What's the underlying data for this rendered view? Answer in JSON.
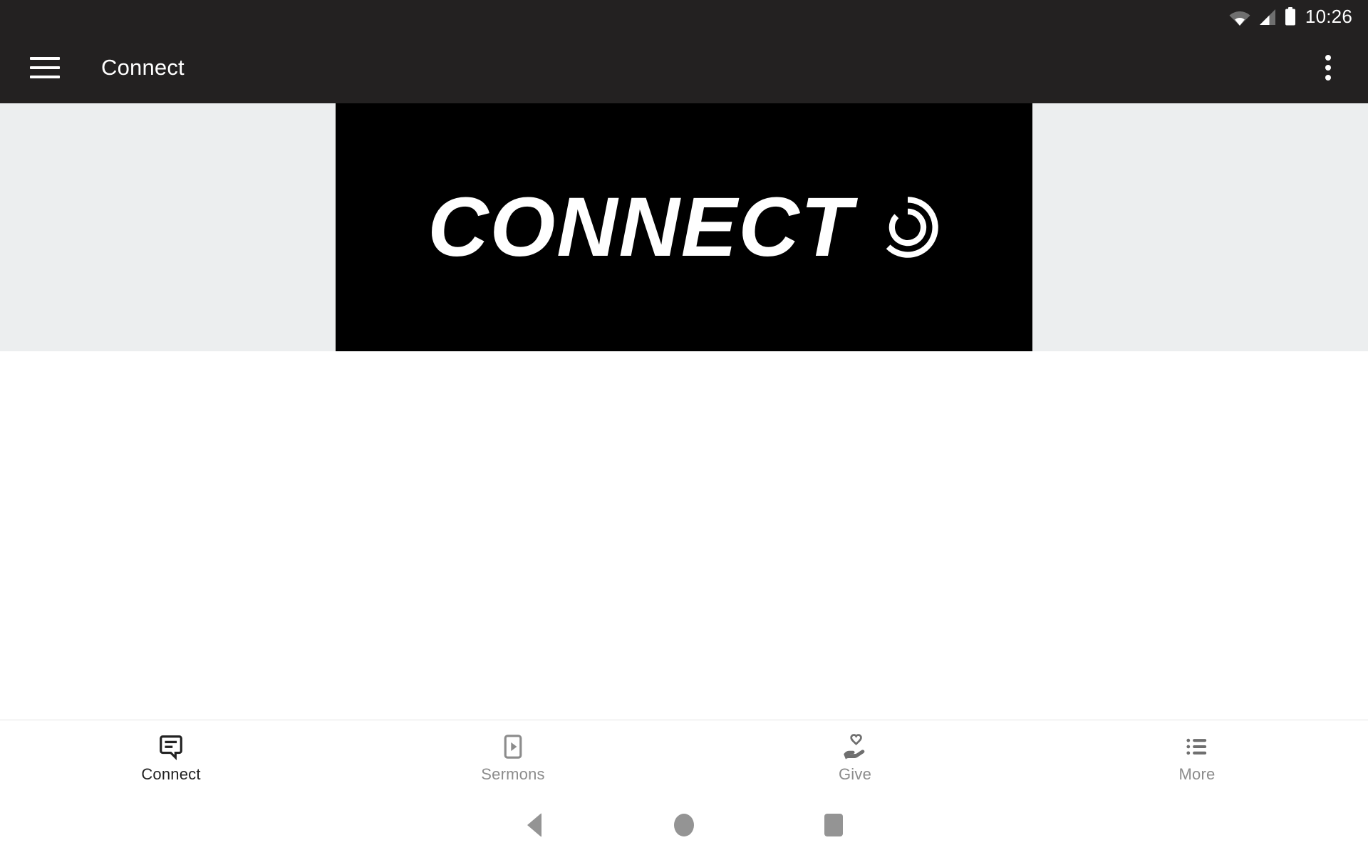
{
  "status_bar": {
    "time": "10:26",
    "icons": [
      "wifi-icon",
      "cellular-signal-icon",
      "battery-icon"
    ],
    "background_color": "#232121"
  },
  "app_bar": {
    "menu_icon": "hamburger-menu-icon",
    "title": "Connect",
    "overflow_icon": "overflow-menu-icon",
    "background_color": "#232121",
    "text_color": "#ffffff"
  },
  "banner": {
    "band_color": "#ECEEEF",
    "image_background": "#000000",
    "wordmark": "CONNECT",
    "logo_mark": "connect-rings-logo-icon",
    "text_color": "#ffffff"
  },
  "content": {
    "background_color": "#ffffff",
    "body_text": ""
  },
  "tab_bar": {
    "background_color": "#ffffff",
    "active_color": "#222222",
    "inactive_color": "#8c8c8c",
    "tabs": [
      {
        "label": "Connect",
        "icon": "chat-bubble-icon",
        "active": true
      },
      {
        "label": "Sermons",
        "icon": "video-play-device-icon",
        "active": false
      },
      {
        "label": "Give",
        "icon": "hand-holding-heart-icon",
        "active": false
      },
      {
        "label": "More",
        "icon": "bulleted-list-icon",
        "active": false
      }
    ]
  },
  "system_nav": {
    "background_color": "#ffffff",
    "icon_color": "#949494",
    "buttons": [
      {
        "name": "back",
        "icon": "back-triangle-icon"
      },
      {
        "name": "home",
        "icon": "home-circle-icon"
      },
      {
        "name": "recents",
        "icon": "recents-square-icon"
      }
    ]
  }
}
